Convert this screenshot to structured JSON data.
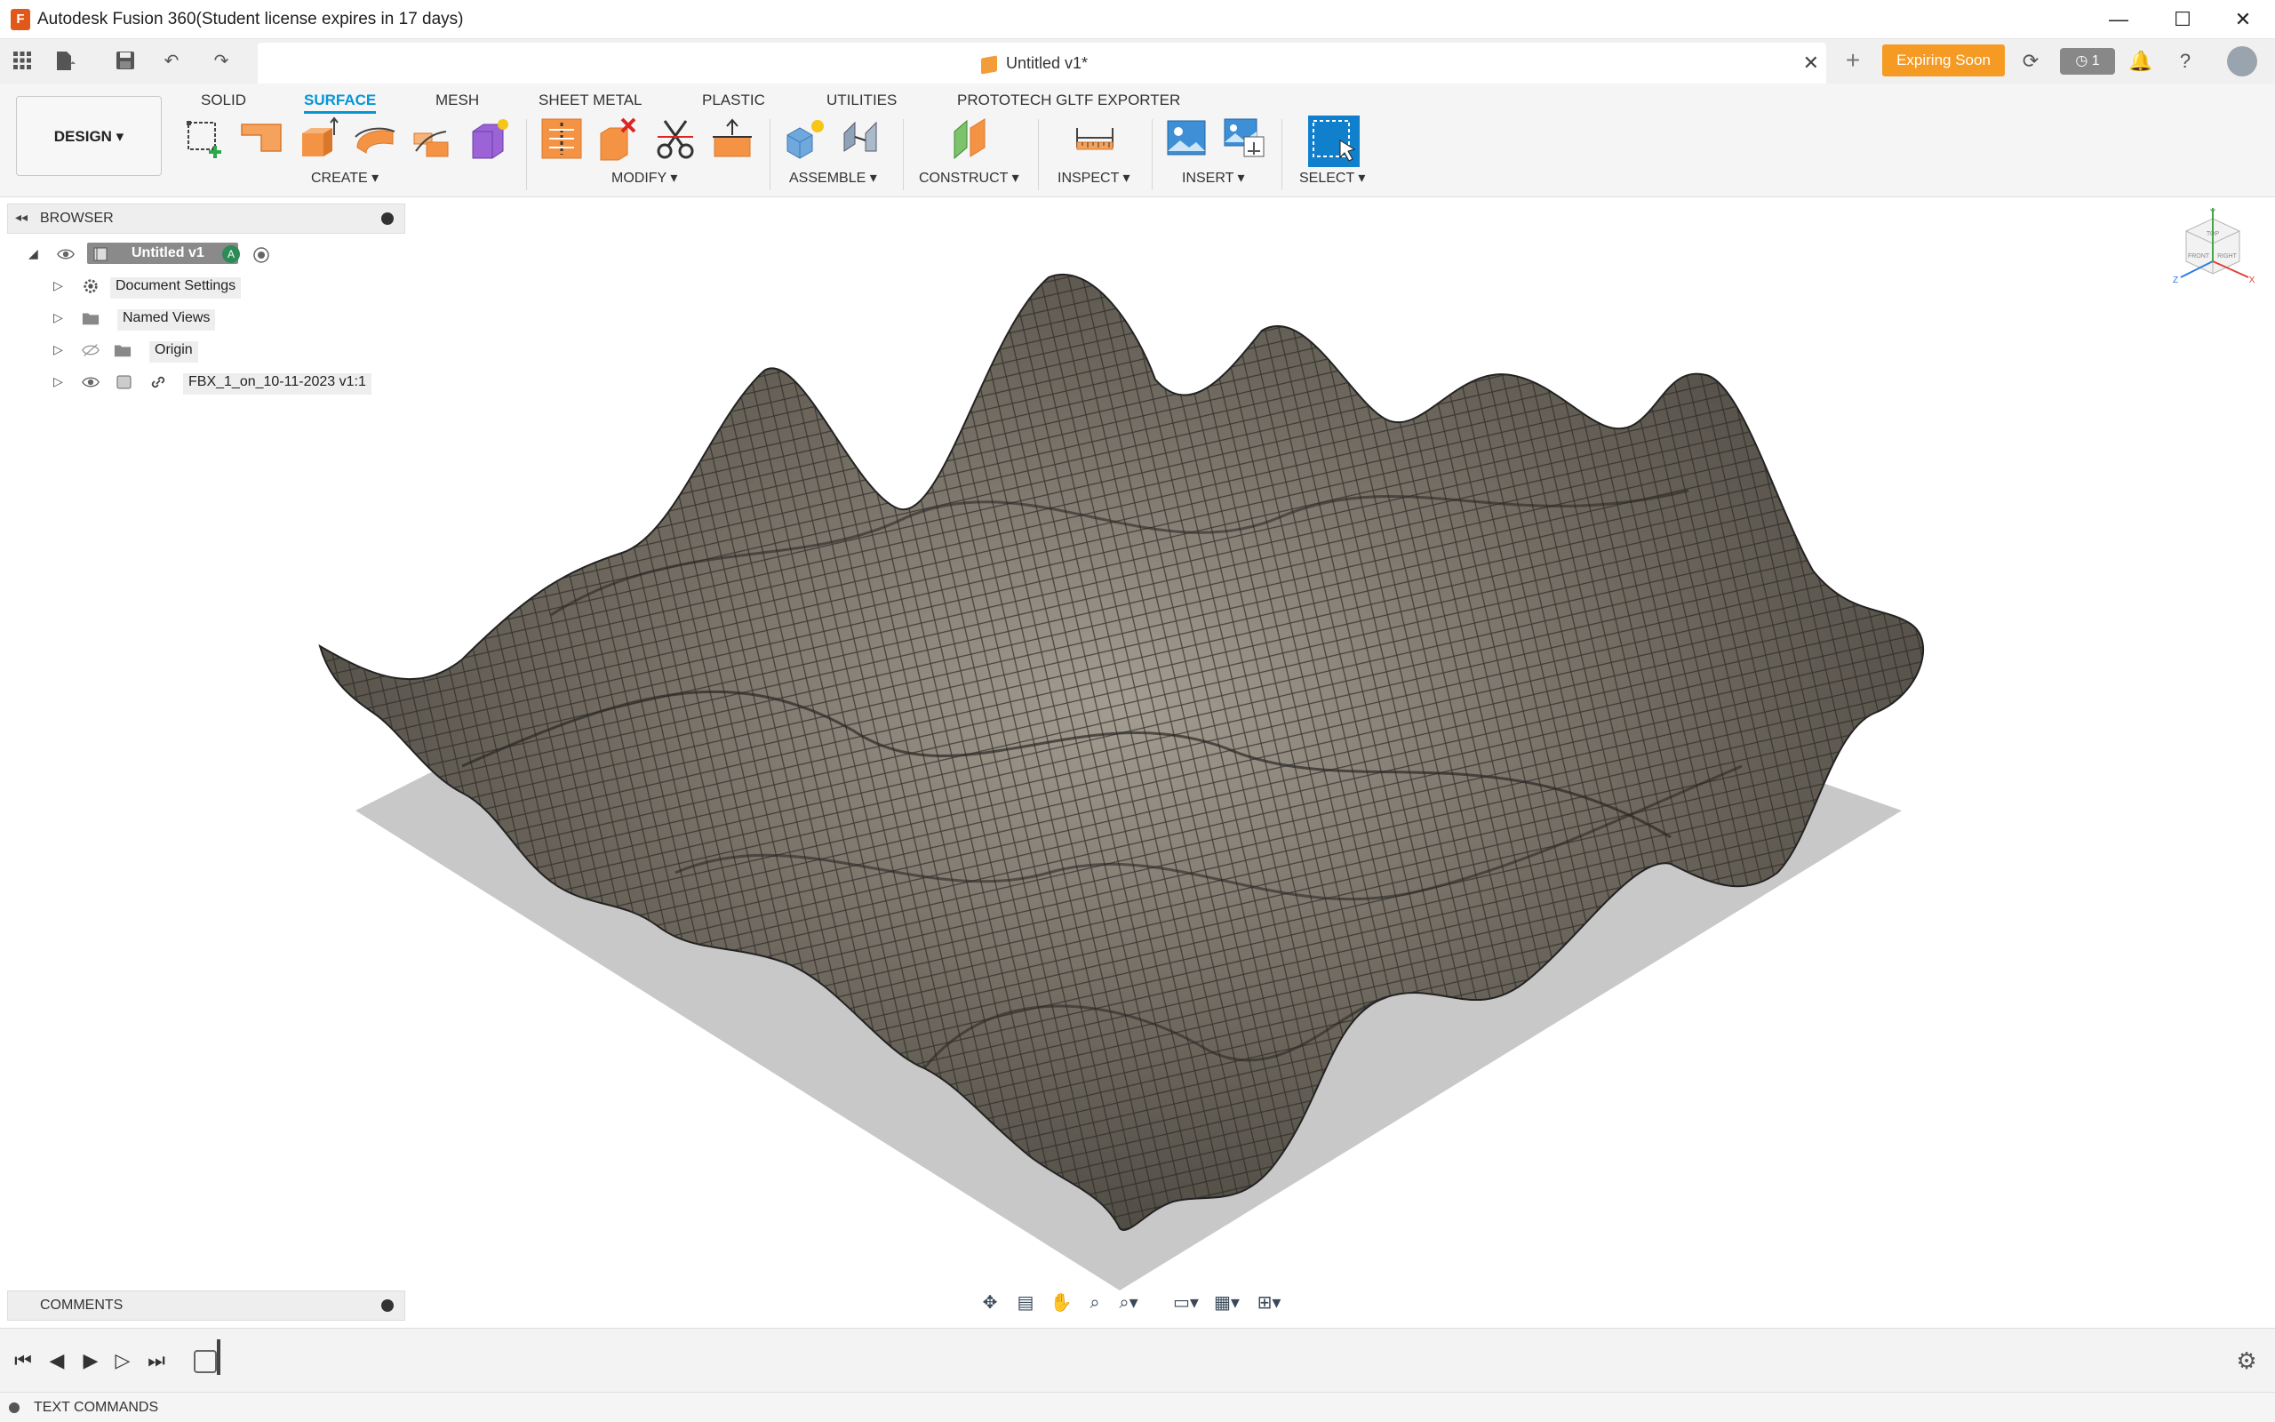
{
  "window": {
    "title": "Autodesk Fusion 360(Student license expires in 17 days)",
    "logo_letter": "F",
    "minimize": "—",
    "maximize": "☐",
    "close": "✕"
  },
  "document_tab": {
    "label": "Untitled v1*",
    "close": "✕"
  },
  "header_right": {
    "expiring_label": "Expiring Soon",
    "job_count": "1"
  },
  "workspace": {
    "label": "DESIGN ▾"
  },
  "tabs": [
    {
      "label": "SOLID",
      "active": false
    },
    {
      "label": "SURFACE",
      "active": true
    },
    {
      "label": "MESH",
      "active": false
    },
    {
      "label": "SHEET METAL",
      "active": false
    },
    {
      "label": "PLASTIC",
      "active": false
    },
    {
      "label": "UTILITIES",
      "active": false
    },
    {
      "label": "PROTOTECH GLTF EXPORTER",
      "active": false
    }
  ],
  "groups": {
    "create": "CREATE ▾",
    "modify": "MODIFY ▾",
    "assemble": "ASSEMBLE ▾",
    "construct": "CONSTRUCT ▾",
    "inspect": "INSPECT ▾",
    "insert": "INSERT ▾",
    "select": "SELECT ▾"
  },
  "browser": {
    "header": "BROWSER",
    "root": "Untitled v1",
    "items": [
      {
        "label": "Document Settings"
      },
      {
        "label": "Named Views"
      },
      {
        "label": "Origin"
      },
      {
        "label": "FBX_1_on_10-11-2023 v1:1"
      }
    ]
  },
  "viewcube": {
    "top": "TOP",
    "front": "FRONT",
    "right": "RIGHT",
    "axis_x": "X",
    "axis_y": "Y",
    "axis_z": "Z"
  },
  "comments": {
    "label": "COMMENTS"
  },
  "text_commands": {
    "label": "TEXT COMMANDS"
  },
  "colors": {
    "accent": "#0696d7",
    "expiring": "#f59a23",
    "mesh": "#6b655c",
    "shadow": "#c8c8c8"
  }
}
